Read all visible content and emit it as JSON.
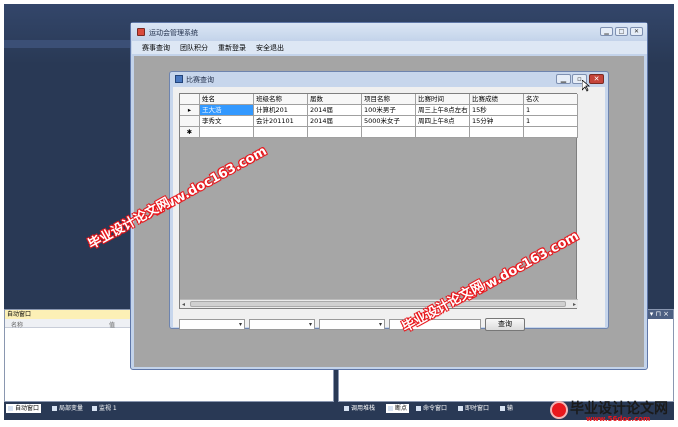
{
  "app": {
    "title": "运动会管理系统",
    "menu": [
      "赛事查询",
      "团队积分",
      "重新登录",
      "安全退出"
    ]
  },
  "child": {
    "title": "比赛查询",
    "columns": [
      "姓名",
      "班级名称",
      "届数",
      "项目名称",
      "比赛时间",
      "比赛成绩",
      "名次"
    ],
    "rows": [
      [
        "王大浩",
        "计算机201",
        "2014届",
        "100米男子",
        "周三上午8点左右",
        "15秒",
        "1"
      ],
      [
        "李秀文",
        "会计201101",
        "2014届",
        "5000米女子",
        "周四上午8点",
        "15分钟",
        "1"
      ]
    ],
    "query_label": "查询"
  },
  "ide": {
    "auto_window_title": "自动窗口",
    "auto_window_cols": [
      "名称",
      "值"
    ],
    "left_tabs": [
      "自动窗口",
      "局部变量",
      "监视 1"
    ],
    "right_tabs": [
      "调用堆栈",
      "断点",
      "命令窗口",
      "即时窗口",
      "输"
    ],
    "pin": "▾ ⊓ ×"
  },
  "watermarks": {
    "site_a": "www.doc163.com",
    "site_b": "毕业设计论文网",
    "brand_name": "毕业设计论文网",
    "brand_url": "www.56doc.com"
  },
  "colors": {
    "ide_bg": "#293955",
    "selection": "#3399ff",
    "watermark_red": "#e8171c"
  }
}
